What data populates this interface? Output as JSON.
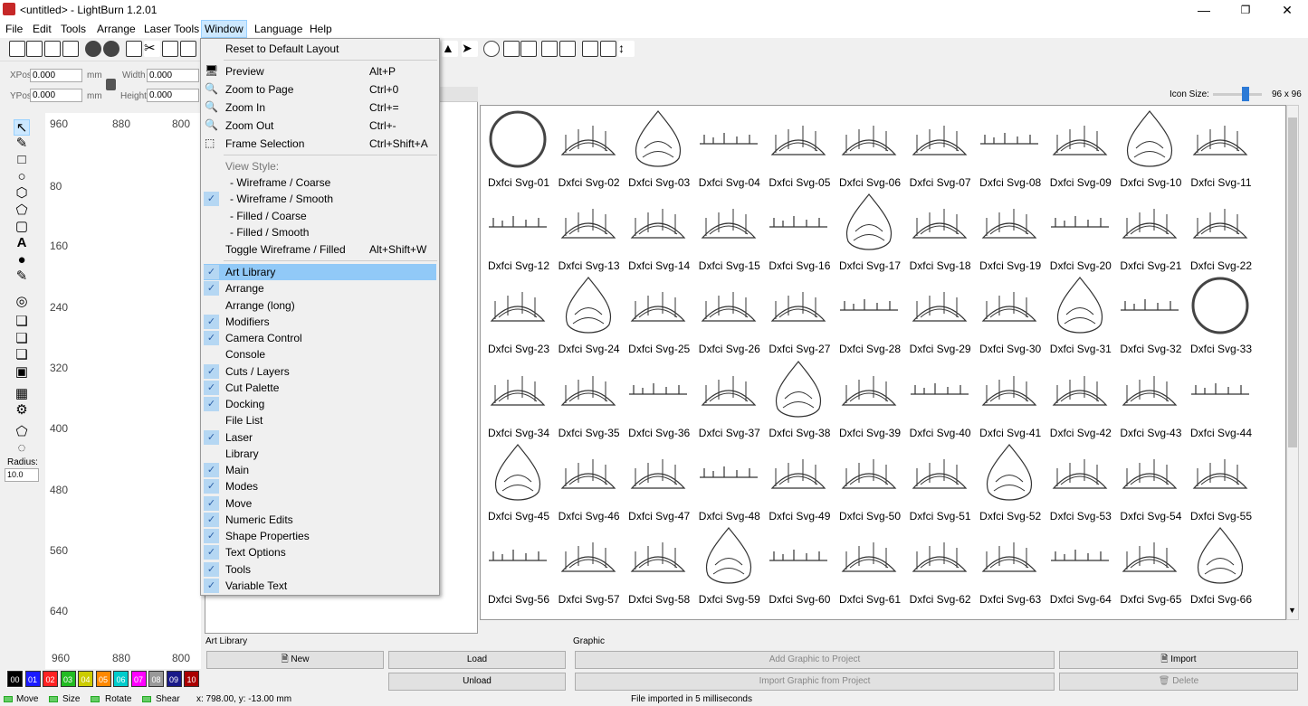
{
  "app": {
    "title": "<untitled> - LightBurn 1.2.01"
  },
  "menus": [
    "File",
    "Edit",
    "Tools",
    "Arrange",
    "Laser Tools",
    "Window",
    "Language",
    "Help"
  ],
  "numeric": {
    "xpos_lbl": "XPos",
    "xpos": "0.000",
    "ypos_lbl": "YPos",
    "ypos": "0.000",
    "unit1": "mm",
    "unit2": "mm",
    "width_lbl": "Width",
    "width": "0.000",
    "height_lbl": "Height",
    "height": "0.000"
  },
  "tools": {
    "radius_lbl": "Radius:",
    "radius_val": "10.0"
  },
  "rulers": {
    "top": [
      "960",
      "880",
      "800"
    ],
    "left": [
      "80",
      "160",
      "240",
      "320",
      "400",
      "480",
      "560",
      "640"
    ],
    "bottom": [
      "960",
      "880",
      "800"
    ]
  },
  "palette": [
    "00",
    "01",
    "02",
    "03",
    "04",
    "05",
    "06",
    "07",
    "08",
    "09",
    "10"
  ],
  "palette_colors": [
    "#000000",
    "#1a1aff",
    "#ff2222",
    "#22bb22",
    "#cccc00",
    "#ff8800",
    "#00cccc",
    "#ff00ff",
    "#999999",
    "#1a1a88",
    "#aa0000"
  ],
  "status": {
    "move": "Move",
    "size": "Size",
    "rotate": "Rotate",
    "shear": "Shear",
    "coords": "x: 798.00, y: -13.00 mm",
    "msg": "File imported in 5 milliseconds"
  },
  "library": {
    "icon_size_lbl": "Icon Size:",
    "icon_size_val": "96 x 96",
    "panel_lbl": "Art Library",
    "graphic_lbl": "Graphic",
    "new": "New",
    "load": "Load",
    "unload": "Unload",
    "add": "Add Graphic to Project",
    "import_graphic": "Import Graphic from Project",
    "import": "Import",
    "delete": "Delete",
    "items": [
      "Dxfci Svg-01",
      "Dxfci Svg-02",
      "Dxfci Svg-03",
      "Dxfci Svg-04",
      "Dxfci Svg-05",
      "Dxfci Svg-06",
      "Dxfci Svg-07",
      "Dxfci Svg-08",
      "Dxfci Svg-09",
      "Dxfci Svg-10",
      "Dxfci Svg-11",
      "Dxfci Svg-12",
      "Dxfci Svg-13",
      "Dxfci Svg-14",
      "Dxfci Svg-15",
      "Dxfci Svg-16",
      "Dxfci Svg-17",
      "Dxfci Svg-18",
      "Dxfci Svg-19",
      "Dxfci Svg-20",
      "Dxfci Svg-21",
      "Dxfci Svg-22",
      "Dxfci Svg-23",
      "Dxfci Svg-24",
      "Dxfci Svg-25",
      "Dxfci Svg-26",
      "Dxfci Svg-27",
      "Dxfci Svg-28",
      "Dxfci Svg-29",
      "Dxfci Svg-30",
      "Dxfci Svg-31",
      "Dxfci Svg-32",
      "Dxfci Svg-33",
      "Dxfci Svg-34",
      "Dxfci Svg-35",
      "Dxfci Svg-36",
      "Dxfci Svg-37",
      "Dxfci Svg-38",
      "Dxfci Svg-39",
      "Dxfci Svg-40",
      "Dxfci Svg-41",
      "Dxfci Svg-42",
      "Dxfci Svg-43",
      "Dxfci Svg-44",
      "Dxfci Svg-45",
      "Dxfci Svg-46",
      "Dxfci Svg-47",
      "Dxfci Svg-48",
      "Dxfci Svg-49",
      "Dxfci Svg-50",
      "Dxfci Svg-51",
      "Dxfci Svg-52",
      "Dxfci Svg-53",
      "Dxfci Svg-54",
      "Dxfci Svg-55",
      "Dxfci Svg-56",
      "Dxfci Svg-57",
      "Dxfci Svg-58",
      "Dxfci Svg-59",
      "Dxfci Svg-60",
      "Dxfci Svg-61",
      "Dxfci Svg-62",
      "Dxfci Svg-63",
      "Dxfci Svg-64",
      "Dxfci Svg-65",
      "Dxfci Svg-66"
    ]
  },
  "window_menu": {
    "reset": "Reset to Default Layout",
    "preview": {
      "label": "Preview",
      "shortcut": "Alt+P"
    },
    "zoom_page": {
      "label": "Zoom to Page",
      "shortcut": "Ctrl+0"
    },
    "zoom_in": {
      "label": "Zoom In",
      "shortcut": "Ctrl+="
    },
    "zoom_out": {
      "label": "Zoom Out",
      "shortcut": "Ctrl+-"
    },
    "frame_sel": {
      "label": "Frame Selection",
      "shortcut": "Ctrl+Shift+A"
    },
    "view_style": "View Style:",
    "wf_coarse": "- Wireframe / Coarse",
    "wf_smooth": "- Wireframe / Smooth",
    "fl_coarse": "- Filled / Coarse",
    "fl_smooth": "- Filled / Smooth",
    "toggle": {
      "label": "Toggle Wireframe / Filled",
      "shortcut": "Alt+Shift+W"
    },
    "panels": [
      {
        "label": "Art Library",
        "checked": true
      },
      {
        "label": "Arrange",
        "checked": true
      },
      {
        "label": "Arrange (long)",
        "checked": false
      },
      {
        "label": "Modifiers",
        "checked": true
      },
      {
        "label": "Camera Control",
        "checked": true
      },
      {
        "label": "Console",
        "checked": false
      },
      {
        "label": "Cuts / Layers",
        "checked": true
      },
      {
        "label": "Cut Palette",
        "checked": true
      },
      {
        "label": "Docking",
        "checked": true
      },
      {
        "label": "File List",
        "checked": false
      },
      {
        "label": "Laser",
        "checked": true
      },
      {
        "label": "Library",
        "checked": false
      },
      {
        "label": "Main",
        "checked": true
      },
      {
        "label": "Modes",
        "checked": true
      },
      {
        "label": "Move",
        "checked": true
      },
      {
        "label": "Numeric Edits",
        "checked": true
      },
      {
        "label": "Shape Properties",
        "checked": true
      },
      {
        "label": "Text Options",
        "checked": true
      },
      {
        "label": "Tools",
        "checked": true
      },
      {
        "label": "Variable Text",
        "checked": true
      }
    ]
  }
}
